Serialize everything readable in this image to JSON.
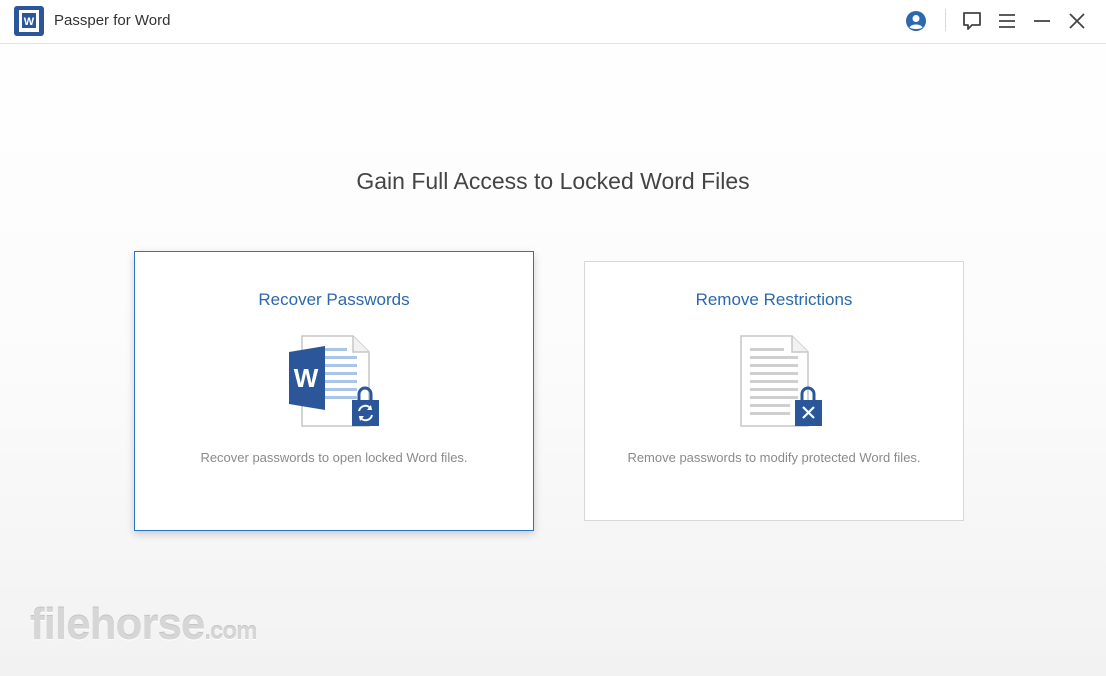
{
  "app": {
    "title": "Passper for Word",
    "logo_letter": "W"
  },
  "titlebar": {
    "icons": [
      "account-icon",
      "feedback-icon",
      "menu-icon",
      "minimize-icon",
      "close-icon"
    ]
  },
  "main": {
    "headline": "Gain Full Access to Locked Word Files",
    "cards": [
      {
        "title": "Recover Passwords",
        "description": "Recover passwords to open locked Word files.",
        "icon": "word-document-lock-refresh-icon"
      },
      {
        "title": "Remove Restrictions",
        "description": "Remove passwords to modify protected Word files.",
        "icon": "document-lock-remove-icon"
      }
    ]
  },
  "watermark": {
    "main": "filehorse",
    "tld": ".com"
  },
  "colors": {
    "accent": "#2b68ad",
    "word_blue": "#2b579a",
    "card_border_selected": "#2a73c5"
  }
}
